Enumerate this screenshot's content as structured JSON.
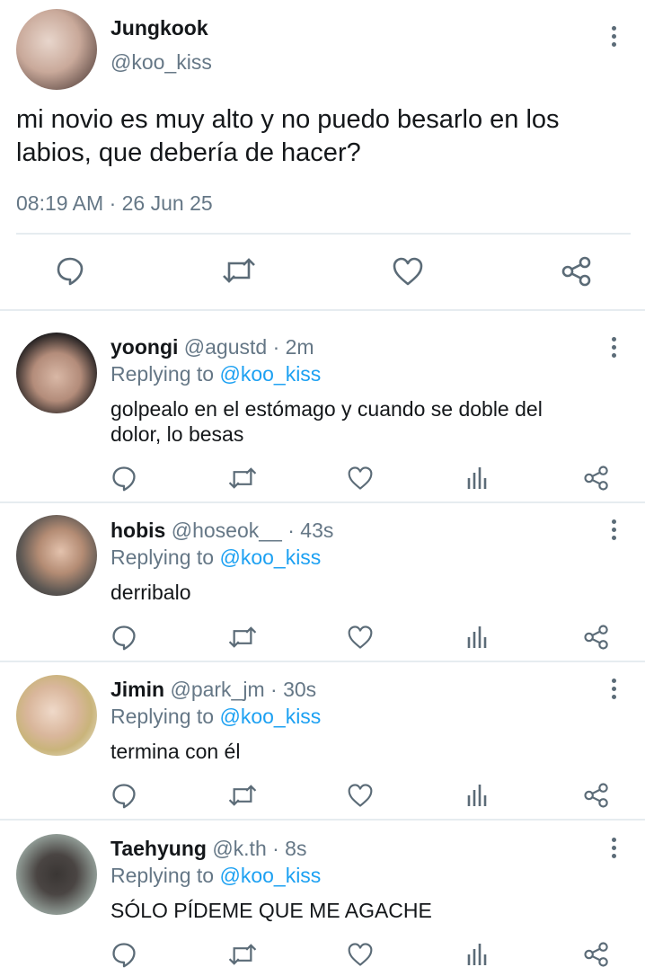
{
  "main_tweet": {
    "name": "Jungkook",
    "handle": "@koo_kiss",
    "text_line1": "mi novio es muy alto y no puedo besarlo en los",
    "text_line2": "labios, que debería de hacer?",
    "timestamp": "08:19 AM · 26 Jun 25",
    "actions": [
      "reply-icon",
      "retweet-icon",
      "like-icon",
      "share-icon"
    ]
  },
  "replies": [
    {
      "name": "yoongi",
      "handle": "@agustd",
      "time": "· 2m",
      "replying_prefix": "Replying to",
      "replying_to": "@koo_kiss",
      "text_line1": "golpealo en el estómago y cuando se doble del",
      "text_line2": "dolor, lo besas"
    },
    {
      "name": "hobis",
      "handle": "@hoseok__",
      "time": "· 43s",
      "replying_prefix": "Replying to",
      "replying_to": "@koo_kiss",
      "text_line1": "derribalo",
      "text_line2": ""
    },
    {
      "name": "Jimin",
      "handle": "@park_jm",
      "time": "· 30s",
      "replying_prefix": "Replying to",
      "replying_to": "@koo_kiss",
      "text_line1": "termina con él",
      "text_line2": ""
    },
    {
      "name": "Taehyung",
      "handle": "@k.th",
      "time": "· 8s",
      "replying_prefix": "Replying to",
      "replying_to": "@koo_kiss",
      "text_line1": "SÓLO PÍDEME QUE ME AGACHE",
      "text_line2": ""
    }
  ],
  "reply_actions": [
    "reply-icon",
    "retweet-icon",
    "like-icon",
    "analytics-icon",
    "share-icon"
  ],
  "colors": {
    "link": "#1da1f2",
    "muted": "#657786",
    "icon": "#5b6b77",
    "divider": "#e6ecf0"
  }
}
